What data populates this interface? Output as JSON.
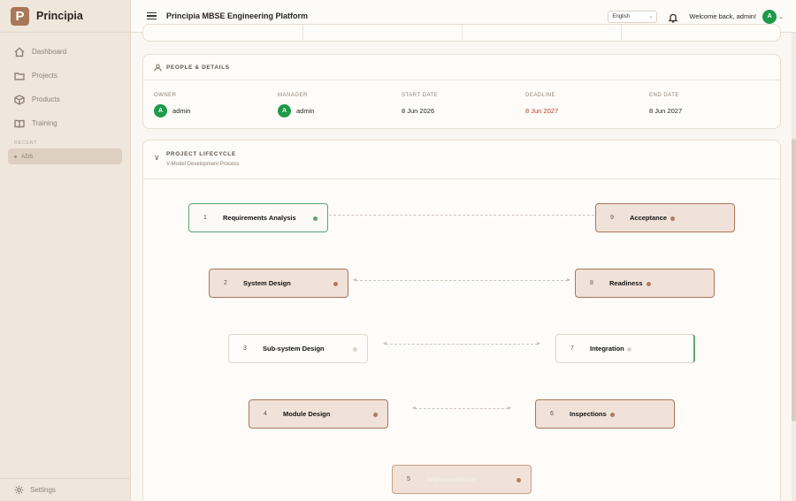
{
  "app": {
    "brand": "Principia",
    "logo_letter": "P",
    "title": "Principia MBSE Engineering Platform"
  },
  "sidebar": {
    "items": [
      {
        "label": "Dashboard",
        "icon": "home-icon"
      },
      {
        "label": "Projects",
        "icon": "folder-icon"
      },
      {
        "label": "Products",
        "icon": "cube-icon"
      },
      {
        "label": "Training",
        "icon": "book-icon"
      }
    ],
    "recent_title": "RECENT",
    "recent_items": [
      {
        "label": "ADS"
      }
    ],
    "footer": {
      "label": "Settings",
      "icon": "gear-icon"
    }
  },
  "header": {
    "language": "English",
    "welcome": "Welcome back, admin!",
    "avatar_letter": "A"
  },
  "people": {
    "title": "PEOPLE & DETAILS",
    "owner_label": "OWNER",
    "owner_value": "admin",
    "owner_avatar": "A",
    "manager_label": "MANAGER",
    "manager_value": "admin",
    "manager_avatar": "A",
    "start_label": "START DATE",
    "start_value": "8 Jun 2026",
    "deadline_label": "DEADLINE",
    "deadline_value": "8 Jun 2027",
    "end_label": "END DATE",
    "end_value": "8 Jun 2027"
  },
  "lifecycle": {
    "title": "PROJECT LIFECYCLE",
    "subtitle": "V-Model Development Process",
    "nodes": [
      {
        "num": "1",
        "label": "Requirements Analysis"
      },
      {
        "num": "2",
        "label": "System Design"
      },
      {
        "num": "3",
        "label": "Sub-system Design"
      },
      {
        "num": "4",
        "label": "Module Design"
      },
      {
        "num": "5",
        "label": "Implementation"
      },
      {
        "num": "6",
        "label": "Inspections"
      },
      {
        "num": "7",
        "label": "Integration"
      },
      {
        "num": "8",
        "label": "Readiness"
      },
      {
        "num": "9",
        "label": "Acceptance"
      }
    ]
  },
  "colors": {
    "accent": "#a97858",
    "active_green": "#5fa277",
    "deadline_red": "#c0392b",
    "avatar_green": "#1e9a4a"
  }
}
